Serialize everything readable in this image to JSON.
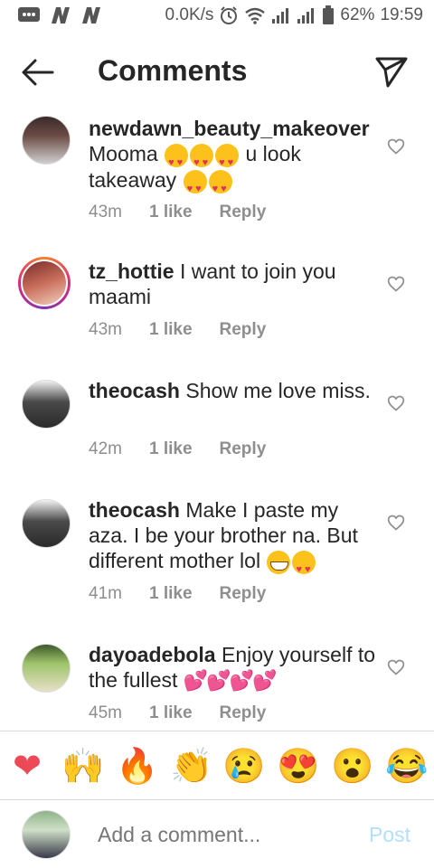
{
  "status_bar": {
    "speed": "0.0K/s",
    "battery": "62%",
    "time": "19:59"
  },
  "header": {
    "title": "Comments"
  },
  "comments": [
    {
      "username": "newdawn_beauty_makeover",
      "text_line1": "Mooma",
      "text_after_emojis": "u look",
      "text_line2": "takeaway",
      "time": "43m",
      "likes": "1 like",
      "reply": "Reply"
    },
    {
      "username": "tz_hottie",
      "text": "I want to join you maami",
      "time": "43m",
      "likes": "1 like",
      "reply": "Reply"
    },
    {
      "username": "theocash",
      "text": "Show me love miss.",
      "time": "42m",
      "likes": "1 like",
      "reply": "Reply"
    },
    {
      "username": "theocash",
      "text": "Make I paste my aza. I be your brother na. But different mother lol",
      "time": "41m",
      "likes": "1 like",
      "reply": "Reply"
    },
    {
      "username": "dayoadebola",
      "text": "Enjoy yourself to the fullest",
      "time": "45m",
      "likes": "1 like",
      "reply": "Reply"
    }
  ],
  "reactions": [
    "❤",
    "🙌",
    "🔥",
    "👏",
    "😢",
    "😍",
    "😮",
    "😂"
  ],
  "composer": {
    "placeholder": "Add a comment...",
    "post_label": "Post"
  },
  "colors": {
    "text": "#262626",
    "meta": "#8e8e8e",
    "post_disabled": "#b2dffc",
    "heart_reaction": "#ed4956"
  }
}
